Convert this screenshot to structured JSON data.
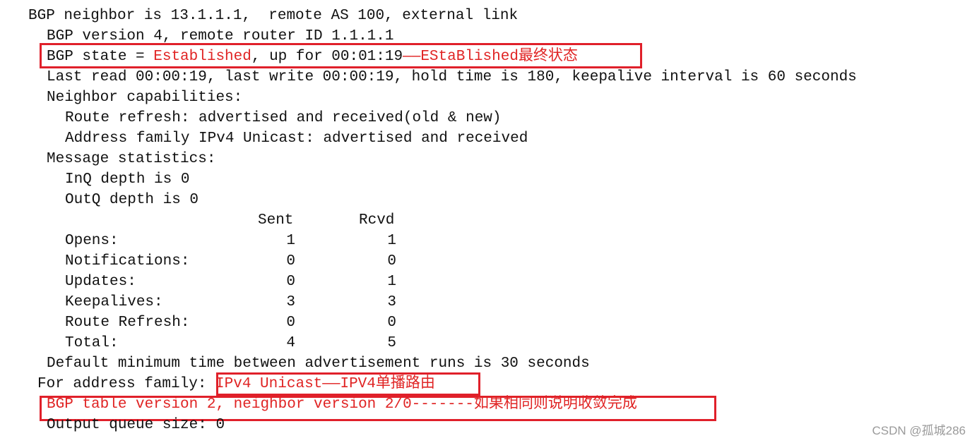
{
  "terminal": {
    "lines": {
      "neighbor": "BGP neighbor is 13.1.1.1,  remote AS 100, external link",
      "version": "BGP version 4, remote router ID 1.1.1.1",
      "state_prefix": "BGP state = ",
      "state_value": "Established",
      "state_suffix": ", up for 00:01:19",
      "state_annotation": "——EStaBlished最终状态",
      "last_read": "Last read 00:00:19, last write 00:00:19, hold time is 180, keepalive interval is 60 seconds",
      "capabilities_header": "Neighbor capabilities:",
      "route_refresh": "Route refresh: advertised and received(old & new)",
      "address_family_cap": "Address family IPv4 Unicast: advertised and received",
      "message_stats_header": "Message statistics:",
      "inq": "InQ depth is 0",
      "outq": "OutQ depth is 0",
      "default_min_time": "Default minimum time between advertisement runs is 30 seconds",
      "for_af_prefix": "For address family: ",
      "for_af_value": "IPv4 Unicast——IPV4单播路由",
      "table_version": "BGP table version 2, neighbor version 2/0-------如果相同则说明收敛完成",
      "output_queue": "Output queue size: 0"
    },
    "stats_table": {
      "headers": [
        "Sent",
        "Rcvd"
      ],
      "rows": [
        {
          "label": "Opens:",
          "sent": "1",
          "rcvd": "1"
        },
        {
          "label": "Notifications:",
          "sent": "0",
          "rcvd": "0"
        },
        {
          "label": "Updates:",
          "sent": "0",
          "rcvd": "1"
        },
        {
          "label": "Keepalives:",
          "sent": "3",
          "rcvd": "3"
        },
        {
          "label": "Route Refresh:",
          "sent": "0",
          "rcvd": "0"
        },
        {
          "label": "Total:",
          "sent": "4",
          "rcvd": "5"
        }
      ]
    }
  },
  "watermark": "CSDN @孤城286",
  "colors": {
    "annotation_red": "#e02424",
    "box_red": "#e0202a",
    "text": "#111111"
  }
}
